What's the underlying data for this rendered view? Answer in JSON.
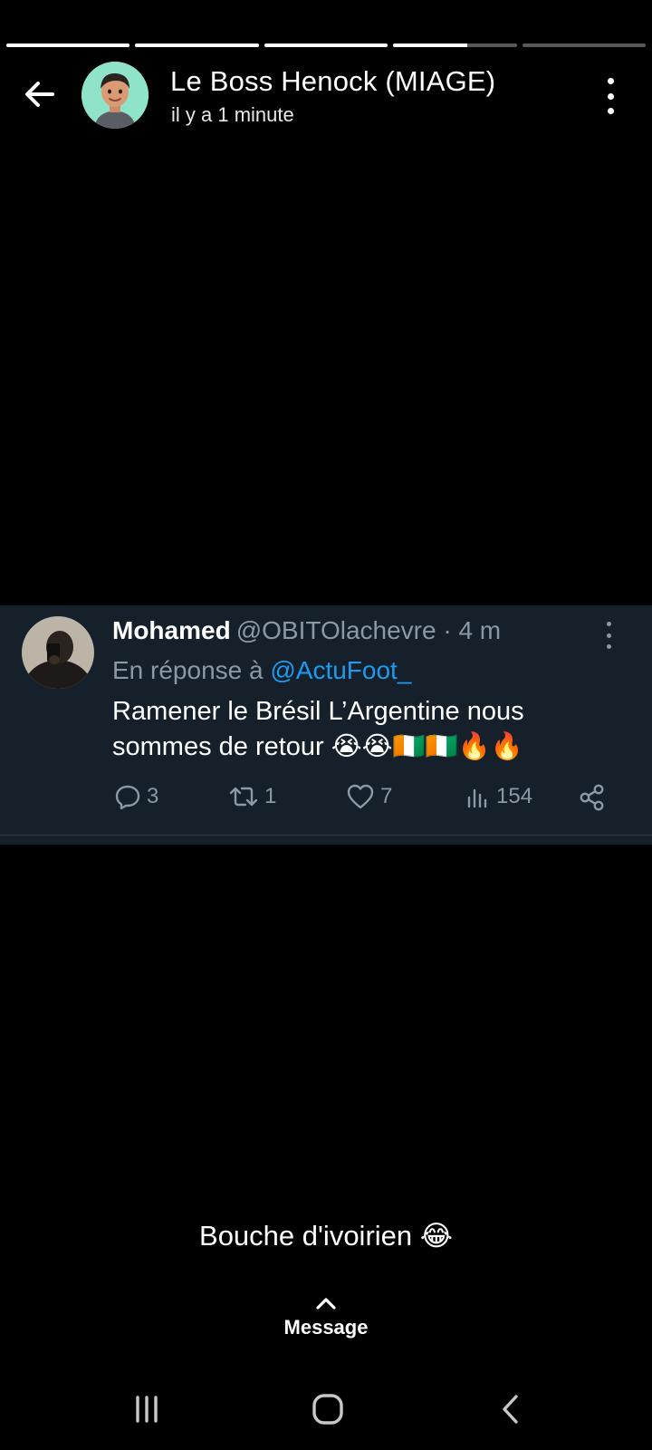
{
  "story": {
    "progress": [
      1,
      1,
      1,
      0.6,
      0
    ],
    "author_name": "Le Boss Henock (MIAGE)",
    "time_ago": "il y a 1 minute",
    "caption": "Bouche d'ivoirien 😂",
    "reply_label": "Message"
  },
  "tweet": {
    "name": "Mohamed",
    "handle": "@OBITOlachevre · 4 m",
    "reply_prefix": "En réponse à",
    "reply_mention": "@ActuFoot_",
    "text": "Ramener le Brésil L’Argentine nous sommes de retour 😭😭🇨🇮🇨🇮🔥🔥",
    "replies": "3",
    "retweets": "1",
    "likes": "7",
    "views": "154"
  },
  "colors": {
    "card_bg": "#15202b",
    "muted": "#8b98a5",
    "link": "#1d9bf0",
    "avatar_bg": "#8fe3c8"
  },
  "icons": {
    "back": "arrow-left-icon",
    "more": "kebab-menu-icon",
    "reply": "comment-icon",
    "retweet": "retweet-icon",
    "like": "heart-icon",
    "views": "bar-chart-icon",
    "share": "share-icon",
    "message": "chevron-up-icon",
    "recents": "recent-apps-icon",
    "home": "home-icon",
    "nav_back": "nav-back-icon"
  }
}
